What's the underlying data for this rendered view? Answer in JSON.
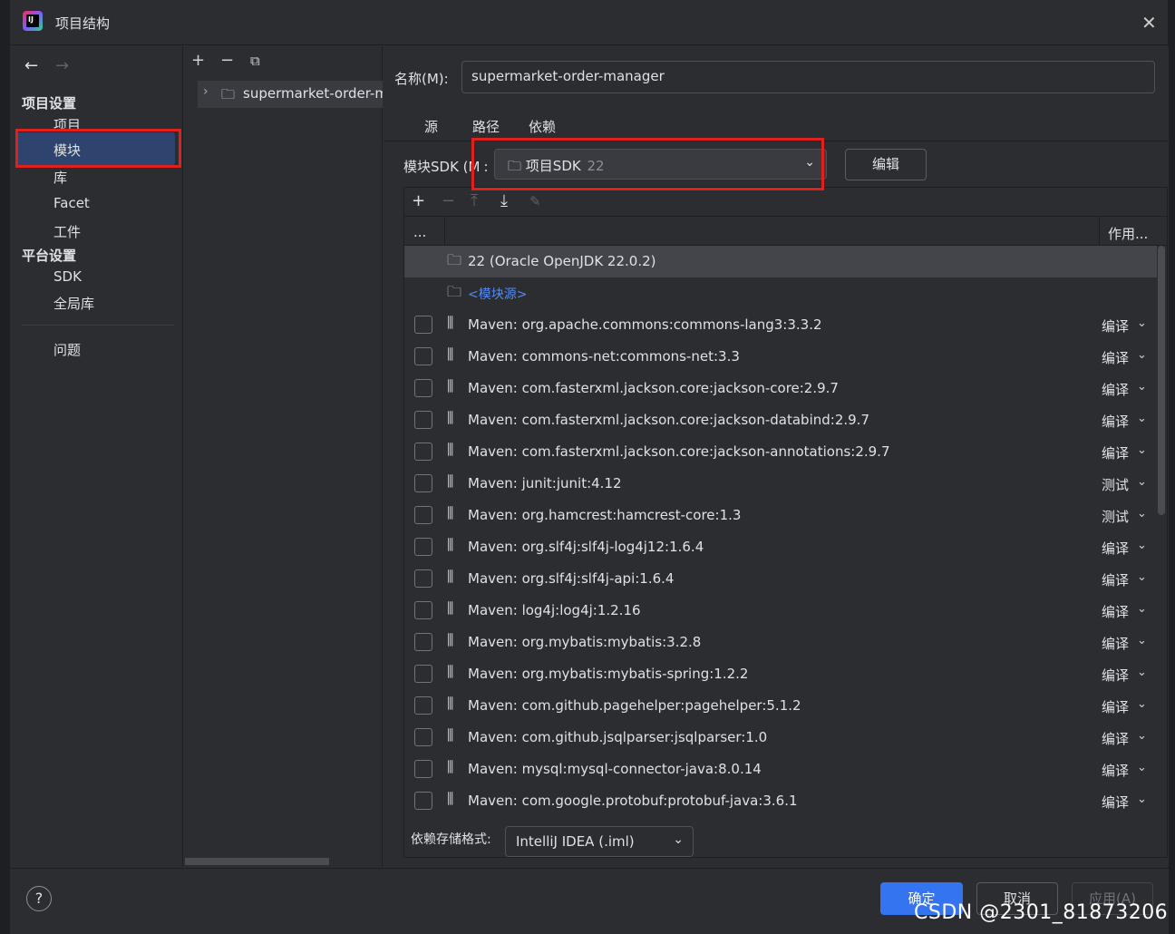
{
  "window": {
    "title": "项目结构",
    "close": "✕"
  },
  "nav": {
    "back": "←",
    "forward": "→",
    "project_settings": "项目设置",
    "items": [
      "项目",
      "模块",
      "库",
      "Facet",
      "工件"
    ],
    "platform_settings": "平台设置",
    "platform_items": [
      "SDK",
      "全局库"
    ],
    "problems": "问题"
  },
  "tree": {
    "add": "+",
    "remove": "−",
    "copy": "⧉",
    "module_name": "supermarket-order-m"
  },
  "main": {
    "name_label": "名称(M):",
    "name_value": "supermarket-order-manager",
    "tabs": [
      "源",
      "路径",
      "依赖"
    ],
    "sdk_label": "模块SDK (M",
    "sdk_colon": ":",
    "sdk_value": "项目SDK",
    "sdk_version": "22",
    "edit_button": "编辑",
    "scope_header": "作用...",
    "col_header": "...",
    "jdk_row": "22 (Oracle OpenJDK 22.0.2)",
    "module_source": "<模块源>",
    "format_label": "依赖存储格式:",
    "format_value": "IntelliJ IDEA (.iml)",
    "dependencies": [
      {
        "name": "Maven: org.apache.commons:commons-lang3:3.3.2",
        "scope": "编译"
      },
      {
        "name": "Maven: commons-net:commons-net:3.3",
        "scope": "编译"
      },
      {
        "name": "Maven: com.fasterxml.jackson.core:jackson-core:2.9.7",
        "scope": "编译"
      },
      {
        "name": "Maven: com.fasterxml.jackson.core:jackson-databind:2.9.7",
        "scope": "编译"
      },
      {
        "name": "Maven: com.fasterxml.jackson.core:jackson-annotations:2.9.7",
        "scope": "编译"
      },
      {
        "name": "Maven: junit:junit:4.12",
        "scope": "测试"
      },
      {
        "name": "Maven: org.hamcrest:hamcrest-core:1.3",
        "scope": "测试"
      },
      {
        "name": "Maven: org.slf4j:slf4j-log4j12:1.6.4",
        "scope": "编译"
      },
      {
        "name": "Maven: org.slf4j:slf4j-api:1.6.4",
        "scope": "编译"
      },
      {
        "name": "Maven: log4j:log4j:1.2.16",
        "scope": "编译"
      },
      {
        "name": "Maven: org.mybatis:mybatis:3.2.8",
        "scope": "编译"
      },
      {
        "name": "Maven: org.mybatis:mybatis-spring:1.2.2",
        "scope": "编译"
      },
      {
        "name": "Maven: com.github.pagehelper:pagehelper:5.1.2",
        "scope": "编译"
      },
      {
        "name": "Maven: com.github.jsqlparser:jsqlparser:1.0",
        "scope": "编译"
      },
      {
        "name": "Maven: mysql:mysql-connector-java:8.0.14",
        "scope": "编译"
      },
      {
        "name": "Maven: com.google.protobuf:protobuf-java:3.6.1",
        "scope": "编译"
      }
    ]
  },
  "footer": {
    "help": "?",
    "ok": "确定",
    "cancel": "取消",
    "apply": "应用(A)"
  },
  "watermark": "CSDN @2301_81873206",
  "colors": {
    "accent": "#3574f0",
    "selection": "#2e436e",
    "highlight_box": "#e0201c"
  }
}
